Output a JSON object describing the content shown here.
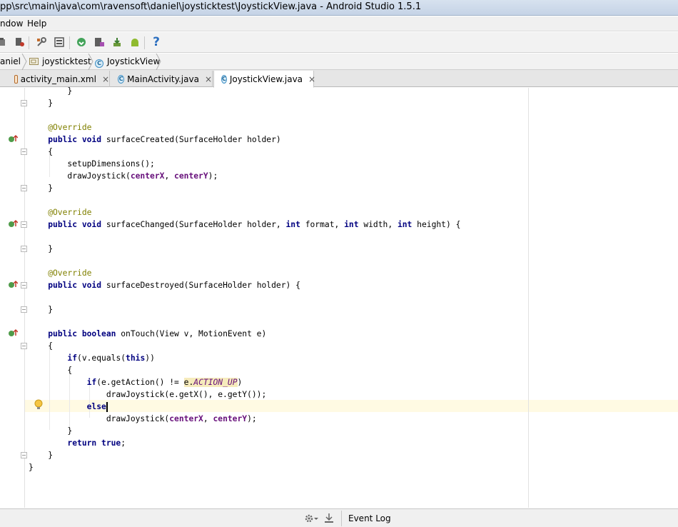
{
  "window": {
    "title": "pp\\src\\main\\java\\com\\ravensoft\\daniel\\joysticktest\\JoystickView.java - Android Studio 1.5.1"
  },
  "menu": {
    "items": [
      "ndow",
      "Help"
    ]
  },
  "toolbar": {
    "icons": [
      "run-debug-icon",
      "attach-icon",
      "project-structure-icon",
      "sdk-manager-icon",
      "sync-icon",
      "device-monitor-icon",
      "avd-manager-icon",
      "download-icon",
      "android-icon",
      "help-icon"
    ],
    "help_label": "?"
  },
  "breadcrumb": {
    "items": [
      "aniel",
      "joysticktest",
      "JoystickView"
    ]
  },
  "tabs": [
    {
      "label": "activity_main.xml",
      "close": "×"
    },
    {
      "label": "MainActivity.java",
      "close": "×"
    },
    {
      "label": "JoystickView.java",
      "close": "×"
    }
  ],
  "colors": {
    "keyword": "#000080",
    "annotation": "#808000",
    "field": "#660e7a",
    "caret_row": "#fffae3",
    "warning_bg": "#f6ebbc"
  },
  "code": {
    "lines": [
      "        }",
      "    }",
      "",
      "    @Override",
      "    public void surfaceCreated(SurfaceHolder holder)",
      "    {",
      "        setupDimensions();",
      "        drawJoystick(centerX, centerY);",
      "    }",
      "",
      "    @Override",
      "    public void surfaceChanged(SurfaceHolder holder, int format, int width, int height) {",
      "",
      "    }",
      "",
      "    @Override",
      "    public void surfaceDestroyed(SurfaceHolder holder) {",
      "",
      "    }",
      "",
      "    public boolean onTouch(View v, MotionEvent e)",
      "    {",
      "        if(v.equals(this))",
      "        {",
      "            if(e.getAction() != e.ACTION_UP)",
      "                drawJoystick(e.getX(), e.getY());",
      "            else",
      "                drawJoystick(centerX, centerY);",
      "        }",
      "        return true;",
      "    }",
      "}"
    ]
  },
  "statusbar": {
    "event_log": "Event Log"
  }
}
